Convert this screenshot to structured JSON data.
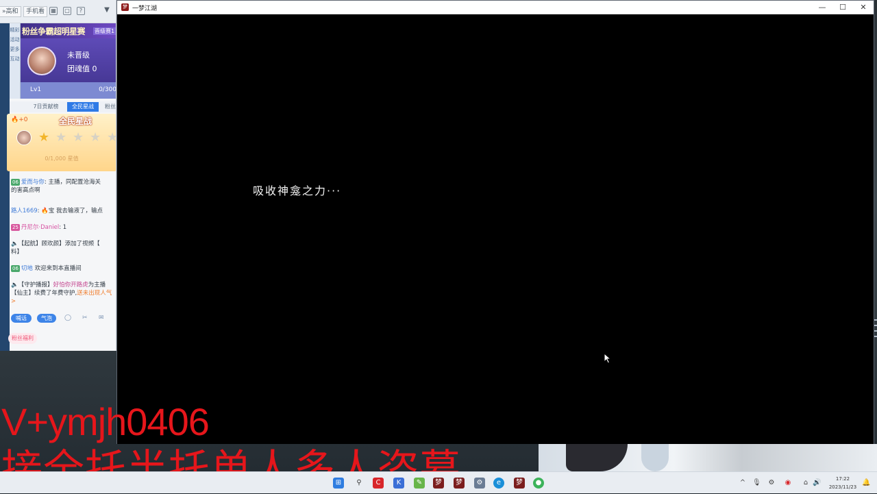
{
  "stream_app": {
    "top_buttons": [
      "»高和",
      "手机看"
    ],
    "banner": {
      "title": "粉丝争霸超明星赛",
      "tag": "晋级赛1"
    },
    "profile": {
      "name": "未晋级",
      "score": "团魂值 0"
    },
    "level": {
      "label": "Lv1",
      "value": "0/300"
    },
    "tabs": [
      "7日贡献榜",
      "全民星战",
      "粉丝"
    ],
    "star_card": {
      "title": "全民星战",
      "fire": "+0",
      "stars_on": 1,
      "stars_total": 5,
      "progress": "0/1,000 星值"
    },
    "chat": [
      {
        "badge": "06",
        "user": "爱而与你",
        "text": ": 主播，同配置沧海关"
      },
      {
        "text": "的害高点啊"
      },
      {
        "user": "路人1669",
        "text": ": 🔥宝 我去输液了，输点"
      },
      {
        "badge": "25",
        "user": "丹尼尔·Daniel",
        "text": ": 1",
        "pink": true
      },
      {
        "text": "【起航】顾欢颜】添加了视频【"
      },
      {
        "text": "料】"
      },
      {
        "badge": "06",
        "user": "切地",
        "text": "  欢迎来到本直播间"
      },
      {
        "text": "【守护播报】",
        "hl": "好怕你开路虎",
        "rest": "为主播"
      },
      {
        "text": "【仙主】续费了年费守护,",
        "hl2": "送未出现人气"
      },
      {
        "text": ">"
      }
    ],
    "action_buttons": [
      "喊话",
      "气泡"
    ],
    "fan_button": "粉丝福利"
  },
  "game_window": {
    "title": "一梦江湖",
    "controls": [
      "—",
      "☐",
      "✕"
    ],
    "loading_text": "吸收神龛之力···"
  },
  "watermark": {
    "line1": "V+ymjh0406",
    "line2": "接全托半托单人多人盗墓"
  },
  "taskbar": {
    "time": "17:22",
    "date": "2023/11/23"
  },
  "colors": {
    "watermark": "#e6161b",
    "accent_blue": "#2e7ae6",
    "profile_purple": "#5e4bb7"
  }
}
